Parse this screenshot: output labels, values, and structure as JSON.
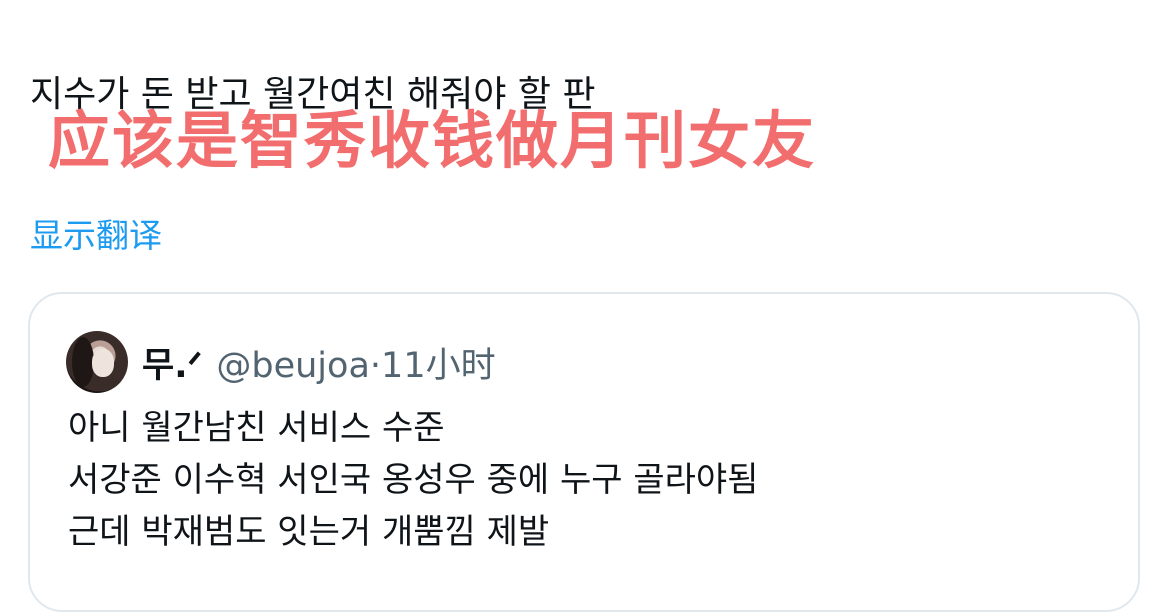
{
  "tweet": {
    "text": "지수가 돈 받고 월간여친 해줘야 할 판",
    "show_translation": "显示翻译"
  },
  "overlay": {
    "caption": "应该是智秀收钱做月刊女友"
  },
  "quote": {
    "author_name": "무.ᐟ",
    "handle": "@beujoa",
    "separator": "·",
    "time": "11小时",
    "lines": [
      "아니 월간남친 서비스 수준",
      "서강준 이수혁 서인국 옹성우 중에 누구 골라야됨",
      "근데 박재범도 잇는거 개뿜낌 제발"
    ]
  },
  "colors": {
    "text_primary": "#0f1419",
    "text_secondary": "#536471",
    "link_blue": "#1d9bf0",
    "overlay_red": "#f26d6d",
    "card_border": "#e1e8ed"
  }
}
